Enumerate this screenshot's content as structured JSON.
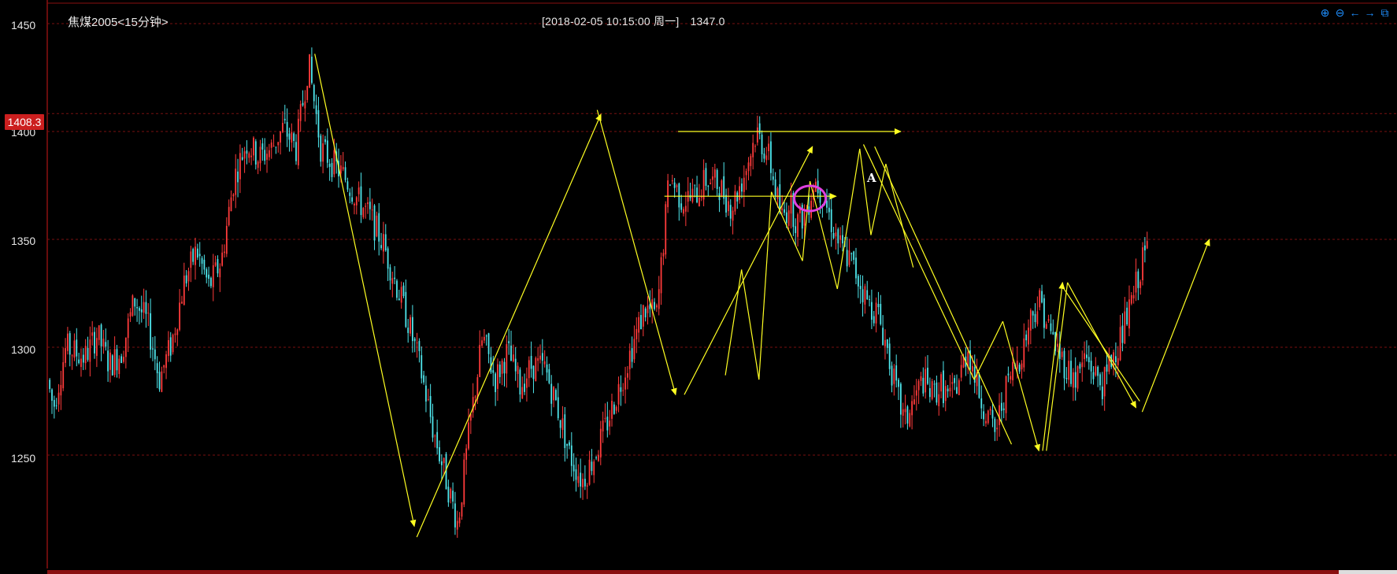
{
  "header": {
    "symbol": "焦煤2005<15分钟>",
    "datetime": "[2018-02-05  10:15:00 周一]",
    "price": "1347.0"
  },
  "current_price_badge": "1408.3",
  "toolbar": [
    {
      "name": "zoom-in-icon",
      "glyph": "⊕"
    },
    {
      "name": "zoom-out-icon",
      "glyph": "⊖"
    },
    {
      "name": "scroll-left-icon",
      "glyph": "←"
    },
    {
      "name": "scroll-right-icon",
      "glyph": "→"
    },
    {
      "name": "popout-icon",
      "glyph": "⧉"
    }
  ],
  "annotation_label": "A",
  "colors": {
    "up": "#ff3b3b",
    "down": "#4fe6ec",
    "line": "#ffff22",
    "grid": "#7a1010",
    "circle": "#e040e0"
  },
  "chart_data": {
    "type": "candlestick",
    "title": "焦煤2005<15分钟>",
    "ylim": [
      1205,
      1460
    ],
    "y_ticks": [
      1450,
      1400,
      1350,
      1300,
      1250
    ],
    "x_range": [
      0,
      100
    ],
    "grid": "horizontal dashed",
    "price_path": [
      [
        0,
        1285
      ],
      [
        0.5,
        1272
      ],
      [
        1.5,
        1300
      ],
      [
        3,
        1295
      ],
      [
        4,
        1306
      ],
      [
        5,
        1292
      ],
      [
        6,
        1298
      ],
      [
        7,
        1322
      ],
      [
        8,
        1312
      ],
      [
        8.5,
        1300
      ],
      [
        9,
        1285
      ],
      [
        10,
        1302
      ],
      [
        11,
        1330
      ],
      [
        12,
        1345
      ],
      [
        13,
        1328
      ],
      [
        14,
        1340
      ],
      [
        15,
        1378
      ],
      [
        16,
        1395
      ],
      [
        17,
        1388
      ],
      [
        18,
        1392
      ],
      [
        19,
        1402
      ],
      [
        20,
        1392
      ],
      [
        21,
        1432
      ],
      [
        22,
        1392
      ],
      [
        23,
        1385
      ],
      [
        24,
        1378
      ],
      [
        25,
        1368
      ],
      [
        26,
        1360
      ],
      [
        27,
        1348
      ],
      [
        28,
        1330
      ],
      [
        29,
        1312
      ],
      [
        30,
        1290
      ],
      [
        31,
        1262
      ],
      [
        32,
        1240
      ],
      [
        33,
        1218
      ],
      [
        34,
        1265
      ],
      [
        35,
        1305
      ],
      [
        36,
        1285
      ],
      [
        37,
        1298
      ],
      [
        38,
        1282
      ],
      [
        39,
        1292
      ],
      [
        40,
        1290
      ],
      [
        41,
        1272
      ],
      [
        42,
        1250
      ],
      [
        43,
        1238
      ],
      [
        44,
        1250
      ],
      [
        45,
        1265
      ],
      [
        46,
        1282
      ],
      [
        47,
        1300
      ],
      [
        48,
        1318
      ],
      [
        49,
        1315
      ],
      [
        50,
        1380
      ],
      [
        51,
        1368
      ],
      [
        52,
        1370
      ],
      [
        53,
        1378
      ],
      [
        54,
        1375
      ],
      [
        55,
        1365
      ],
      [
        56,
        1380
      ],
      [
        57,
        1400
      ],
      [
        58,
        1388
      ],
      [
        59,
        1360
      ],
      [
        60,
        1368
      ],
      [
        61,
        1380
      ],
      [
        62,
        1395
      ],
      [
        63,
        1382
      ],
      [
        64,
        1372
      ],
      [
        65,
        1355
      ],
      [
        66,
        1305
      ],
      [
        67,
        1298
      ],
      [
        68,
        1328
      ],
      [
        69,
        1318
      ],
      [
        70,
        1308
      ],
      [
        71,
        1285
      ],
      [
        72,
        1282
      ],
      [
        73,
        1285
      ],
      [
        74,
        1310
      ],
      [
        75,
        1296
      ],
      [
        76,
        1322
      ],
      [
        77,
        1360
      ],
      [
        78,
        1372
      ],
      [
        79,
        1352
      ],
      [
        80,
        1348
      ],
      [
        81,
        1345
      ],
      [
        82,
        1365
      ],
      [
        83,
        1350
      ],
      [
        84,
        1342
      ],
      [
        85,
        1355
      ],
      [
        86,
        1370
      ],
      [
        87,
        1378
      ],
      [
        88,
        1390
      ],
      [
        89,
        1385
      ],
      [
        90,
        1375
      ],
      [
        91,
        1365
      ],
      [
        92,
        1370
      ],
      [
        93,
        1358
      ],
      [
        94,
        1360
      ],
      [
        95,
        1362
      ],
      [
        96,
        1345
      ],
      [
        97,
        1340
      ],
      [
        98,
        1330
      ],
      [
        99,
        1325
      ],
      [
        100,
        1318
      ]
    ],
    "price_path_right": [
      [
        59.5,
        1370
      ],
      [
        60.5,
        1358
      ],
      [
        61.5,
        1362
      ],
      [
        62.5,
        1378
      ],
      [
        63.5,
        1370
      ],
      [
        64.5,
        1356
      ],
      [
        65.5,
        1345
      ],
      [
        66.5,
        1340
      ],
      [
        67.5,
        1330
      ],
      [
        68.5,
        1320
      ],
      [
        69.5,
        1316
      ],
      [
        70.5,
        1300
      ],
      [
        71.5,
        1280
      ],
      [
        72.5,
        1265
      ],
      [
        73.5,
        1275
      ],
      [
        74.5,
        1285
      ],
      [
        75.5,
        1278
      ],
      [
        76.5,
        1282
      ],
      [
        77.5,
        1276
      ],
      [
        78.5,
        1285
      ],
      [
        79.5,
        1300
      ],
      [
        80.5,
        1282
      ],
      [
        81.5,
        1270
      ],
      [
        82.5,
        1260
      ],
      [
        83.5,
        1278
      ],
      [
        84.5,
        1290
      ],
      [
        85.5,
        1298
      ],
      [
        86.5,
        1315
      ],
      [
        87.5,
        1322
      ],
      [
        88.5,
        1308
      ],
      [
        89.5,
        1298
      ],
      [
        90.5,
        1290
      ],
      [
        91.5,
        1285
      ],
      [
        92.5,
        1296
      ],
      [
        93.5,
        1288
      ],
      [
        94.5,
        1282
      ],
      [
        95.5,
        1296
      ],
      [
        96.5,
        1305
      ],
      [
        97.5,
        1318
      ],
      [
        98.5,
        1335
      ],
      [
        99.5,
        1348
      ]
    ],
    "trend_lines": [
      {
        "from": [
          21.5,
          1436
        ],
        "to": [
          29.5,
          1217
        ],
        "arrow": true
      },
      {
        "from": [
          29.7,
          1212
        ],
        "to": [
          44.5,
          1408
        ],
        "arrow": true
      },
      {
        "from": [
          44.2,
          1410
        ],
        "to": [
          50.5,
          1278
        ],
        "arrow": true
      },
      {
        "from": [
          51.2,
          1278
        ],
        "to": [
          61.5,
          1393
        ],
        "arrow": true
      },
      {
        "from": [
          54.5,
          1287
        ],
        "to": [
          55.8,
          1336
        ],
        "arrow": false
      },
      {
        "from": [
          55.8,
          1336
        ],
        "to": [
          57.2,
          1285
        ],
        "arrow": false
      },
      {
        "from": [
          57.2,
          1285
        ],
        "to": [
          58.2,
          1372
        ],
        "arrow": false
      },
      {
        "from": [
          58.2,
          1372
        ],
        "to": [
          60.7,
          1340
        ],
        "arrow": false
      },
      {
        "from": [
          60.7,
          1340
        ],
        "to": [
          61.3,
          1377
        ],
        "arrow": false
      },
      {
        "from": [
          61.3,
          1377
        ],
        "to": [
          63.5,
          1327
        ],
        "arrow": false
      },
      {
        "from": [
          63.5,
          1327
        ],
        "to": [
          65.3,
          1392
        ],
        "arrow": false
      },
      {
        "from": [
          65.3,
          1392
        ],
        "to": [
          66.2,
          1352
        ],
        "arrow": false
      },
      {
        "from": [
          66.2,
          1352
        ],
        "to": [
          67.4,
          1385
        ],
        "arrow": false
      },
      {
        "from": [
          67.4,
          1385
        ],
        "to": [
          69.6,
          1337
        ],
        "arrow": false
      },
      {
        "from": [
          65.6,
          1394
        ],
        "to": [
          74.5,
          1285
        ],
        "arrow": false
      },
      {
        "from": [
          74.5,
          1285
        ],
        "to": [
          76.8,
          1312
        ],
        "arrow": false
      },
      {
        "from": [
          76.8,
          1312
        ],
        "to": [
          79.7,
          1252
        ],
        "arrow": true
      },
      {
        "from": [
          66.5,
          1393
        ],
        "to": [
          77.5,
          1255
        ],
        "arrow": false
      },
      {
        "from": [
          80.0,
          1252
        ],
        "to": [
          81.6,
          1330
        ],
        "arrow": true
      },
      {
        "from": [
          80.3,
          1252
        ],
        "to": [
          82.0,
          1330
        ],
        "arrow": false
      },
      {
        "from": [
          82.0,
          1330
        ],
        "to": [
          87.5,
          1272
        ],
        "arrow": true
      },
      {
        "from": [
          81.6,
          1328
        ],
        "to": [
          87.8,
          1275
        ],
        "arrow": false
      },
      {
        "from": [
          88.0,
          1270
        ],
        "to": [
          93.4,
          1350
        ],
        "arrow": true
      }
    ],
    "horizontal_lines": [
      {
        "from": [
          50.7,
          1400
        ],
        "to": [
          68.6,
          1400
        ],
        "arrow": true
      },
      {
        "from": [
          49.6,
          1370
        ],
        "to": [
          63.4,
          1370
        ],
        "arrow": true
      }
    ],
    "circle": {
      "x": 61.3,
      "y": 1369
    },
    "annotation_point": {
      "x": 66.2,
      "y": 1378
    }
  }
}
